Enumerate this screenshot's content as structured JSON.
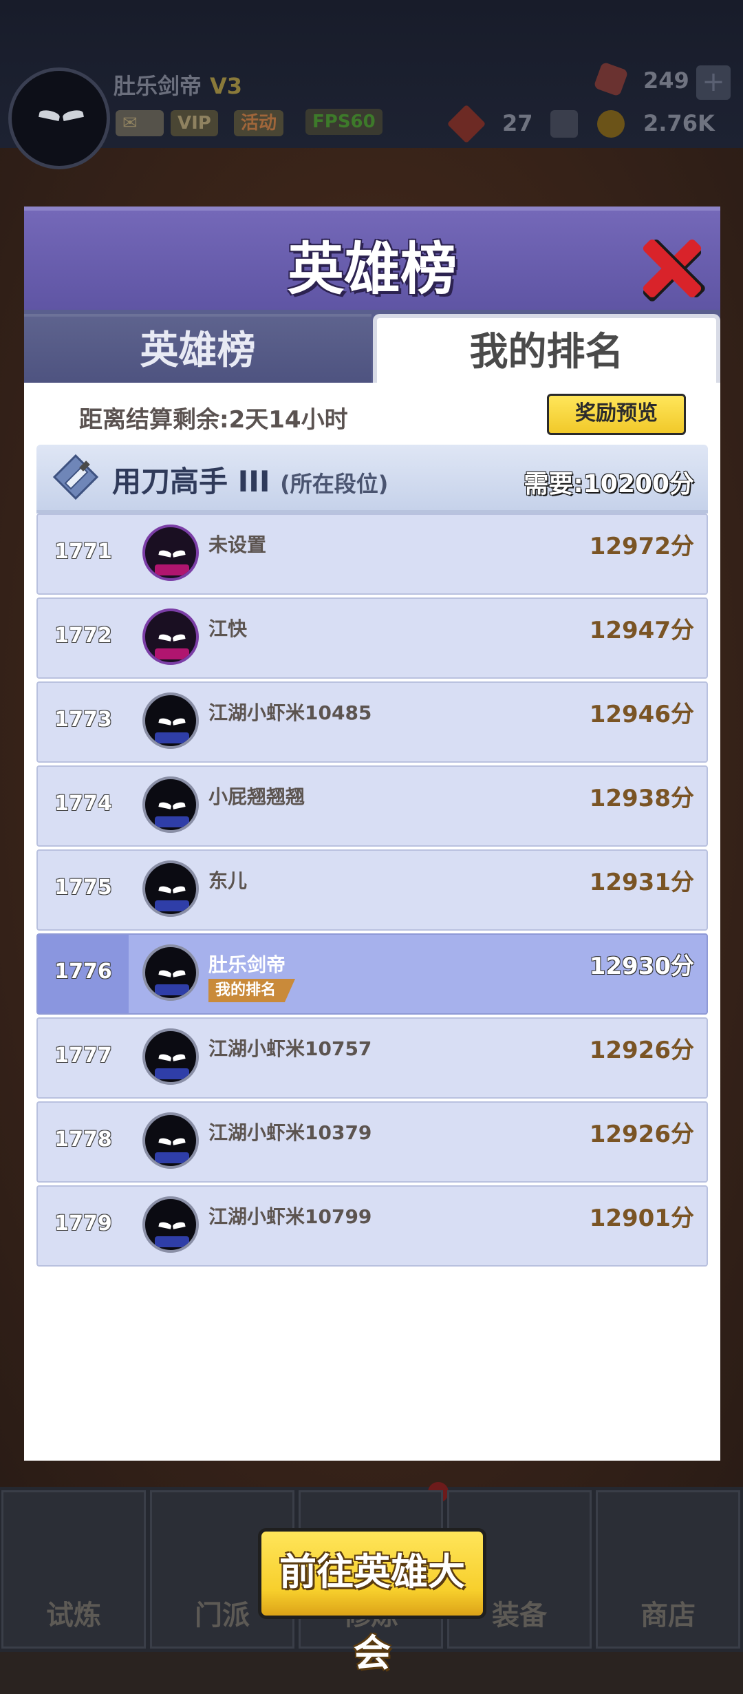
{
  "player": {
    "name": "肚乐剑帝",
    "level": "V3",
    "chips": [
      "VIP",
      "活动",
      "FPS60"
    ],
    "gems": "249",
    "tickets": "27",
    "gold": "2.76K"
  },
  "nav": [
    "试炼",
    "门派",
    "修炼",
    "装备",
    "商店"
  ],
  "modal": {
    "title": "英雄榜",
    "tabs": [
      "英雄榜",
      "我的排名"
    ],
    "active_tab": "我的排名",
    "countdown": "距离结算剩余:2天14小时",
    "reward_button": "奖励预览",
    "tier": {
      "name": "用刀高手 III",
      "sub": "(所在段位)",
      "need": "需要:10200分"
    },
    "my_tag": "我的排名",
    "goto_button": "前往英雄大会"
  },
  "ranking": [
    {
      "rank": "1771",
      "name": "未设置",
      "score": "12972分",
      "avatar": "purple"
    },
    {
      "rank": "1772",
      "name": "江快",
      "score": "12947分",
      "avatar": "purple"
    },
    {
      "rank": "1773",
      "name": "江湖小虾米10485",
      "score": "12946分",
      "avatar": "ninja"
    },
    {
      "rank": "1774",
      "name": "小屁翘翘翘",
      "score": "12938分",
      "avatar": "ninja"
    },
    {
      "rank": "1775",
      "name": "东儿",
      "score": "12931分",
      "avatar": "ninja"
    },
    {
      "rank": "1776",
      "name": "肚乐剑帝",
      "score": "12930分",
      "avatar": "ninja",
      "me": true
    },
    {
      "rank": "1777",
      "name": "江湖小虾米10757",
      "score": "12926分",
      "avatar": "ninja"
    },
    {
      "rank": "1778",
      "name": "江湖小虾米10379",
      "score": "12926分",
      "avatar": "ninja"
    },
    {
      "rank": "1779",
      "name": "江湖小虾米10799",
      "score": "12901分",
      "avatar": "ninja"
    }
  ],
  "colors": {
    "header": "#6a5fae",
    "row": "#d8def4",
    "row_me": "#a6b1ec",
    "button_yellow": "#f7cf2c",
    "close_red": "#d9232a"
  }
}
